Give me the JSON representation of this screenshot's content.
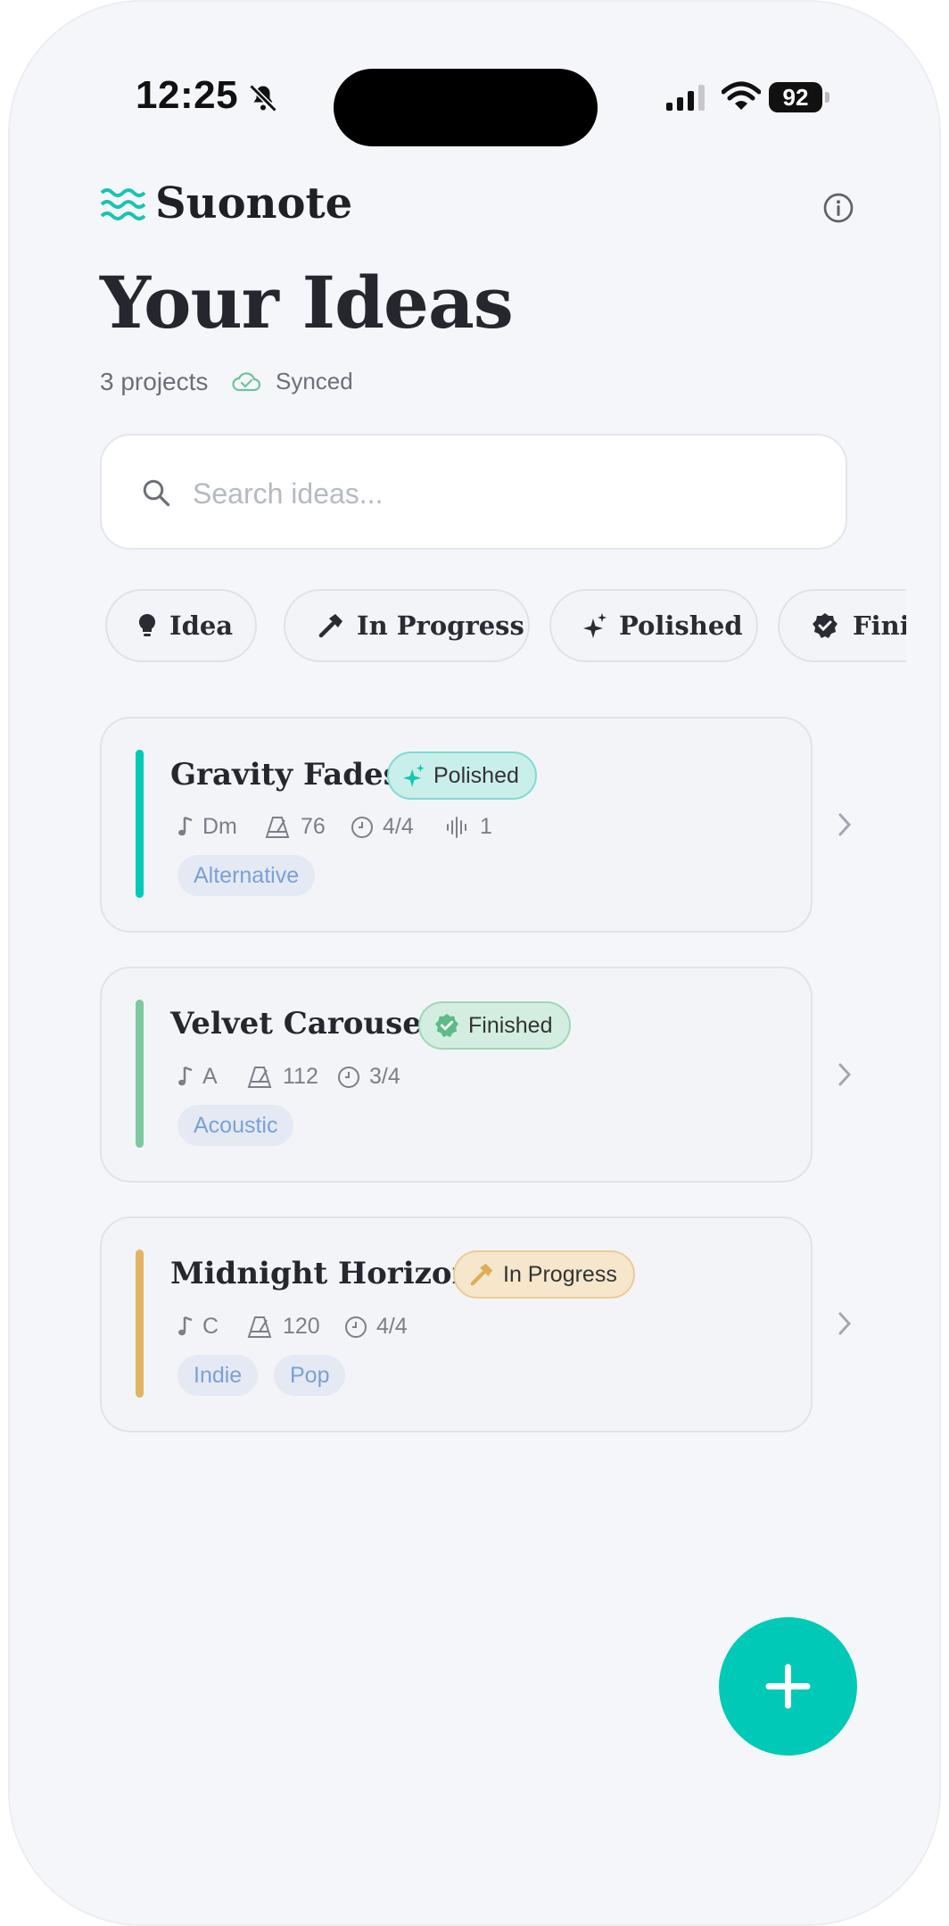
{
  "status_bar": {
    "time": "12:25",
    "battery": "92"
  },
  "header": {
    "brand": "Suonote",
    "title": "Your Ideas",
    "project_count": "3 projects",
    "sync_status": "Synced"
  },
  "search": {
    "placeholder": "Search ideas..."
  },
  "filters": [
    {
      "label": "Idea",
      "icon": "lightbulb-icon"
    },
    {
      "label": "In Progress",
      "icon": "hammer-icon"
    },
    {
      "label": "Polished",
      "icon": "sparkles-icon"
    },
    {
      "label": "Finished",
      "icon": "verified-badge-icon"
    }
  ],
  "projects": [
    {
      "title": "Gravity Fades",
      "status": "Polished",
      "status_color": "#00c9b7",
      "key": "Dm",
      "bpm": "76",
      "time_signature": "4/4",
      "takes": "1",
      "tags": [
        "Alternative"
      ]
    },
    {
      "title": "Velvet Carousel",
      "status": "Finished",
      "status_color": "#7ec8a0",
      "key": "A",
      "bpm": "112",
      "time_signature": "3/4",
      "tags": [
        "Acoustic"
      ]
    },
    {
      "title": "Midnight Horizon",
      "status": "In Progress",
      "status_color": "#e2b565",
      "key": "C",
      "bpm": "120",
      "time_signature": "4/4",
      "tags": [
        "Indie",
        "Pop"
      ]
    }
  ],
  "colors": {
    "accent": "#00c9b7",
    "background": "#f5f6fa",
    "tag_text": "#7aa1d6"
  }
}
